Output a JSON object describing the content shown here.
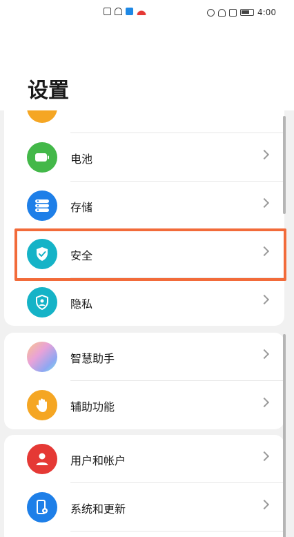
{
  "status_bar": {
    "time": "4:00"
  },
  "header": {
    "title": "设置"
  },
  "group1": {
    "items": [
      {
        "label": "电池",
        "icon": "battery-icon",
        "color": "#43b849"
      },
      {
        "label": "存储",
        "icon": "storage-icon",
        "color": "#1e7fe8"
      },
      {
        "label": "安全",
        "icon": "shield-check-icon",
        "color": "#15b3c7"
      },
      {
        "label": "隐私",
        "icon": "privacy-shield-icon",
        "color": "#15b3c7"
      }
    ]
  },
  "group2": {
    "items": [
      {
        "label": "智慧助手",
        "icon": "smart-assistant-icon",
        "color": "#c58be0"
      },
      {
        "label": "辅助功能",
        "icon": "hand-icon",
        "color": "#f5a623"
      }
    ]
  },
  "group3": {
    "items": [
      {
        "label": "用户和帐户",
        "icon": "user-icon",
        "color": "#e53935"
      },
      {
        "label": "系统和更新",
        "icon": "system-update-icon",
        "color": "#1e7fe8"
      }
    ]
  },
  "highlight_color": "#f26b3a"
}
